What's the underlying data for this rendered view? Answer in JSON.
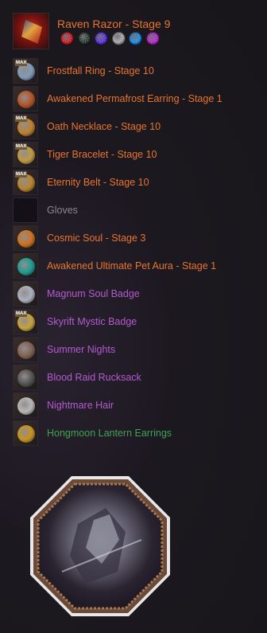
{
  "weapon": {
    "name": "Raven Razor - Stage 9",
    "gems": [
      {
        "icon": "red-gem-icon",
        "color": "#c8202c"
      },
      {
        "icon": "black-gem-icon",
        "color": "#2a3a34"
      },
      {
        "icon": "purple-gem-icon",
        "color": "#5a32d8"
      },
      {
        "icon": "white-gem-icon",
        "color": "#a8a8a8"
      },
      {
        "icon": "blue-gem-icon",
        "color": "#1f8ae0"
      },
      {
        "icon": "magenta-gem-icon",
        "color": "#b02ac8"
      }
    ]
  },
  "equipment": [
    {
      "label": "Frostfall Ring - Stage 10",
      "icon": "ring-icon",
      "rarity": "orange",
      "max": "MAX",
      "color": "#8aa8c8"
    },
    {
      "label": "Awakened Permafrost Earring - Stage 1",
      "icon": "earring-icon",
      "rarity": "orange",
      "max": "",
      "color": "#c45a2a"
    },
    {
      "label": "Oath Necklace - Stage 10",
      "icon": "necklace-icon",
      "rarity": "orange",
      "max": "MAX",
      "color": "#d08a30"
    },
    {
      "label": "Tiger Bracelet - Stage 10",
      "icon": "bracelet-icon",
      "rarity": "orange",
      "max": "MAX",
      "color": "#d0a848"
    },
    {
      "label": "Eternity Belt - Stage 10",
      "icon": "belt-icon",
      "rarity": "orange",
      "max": "MAX",
      "color": "#c89030"
    },
    {
      "label": "Gloves",
      "icon": "empty-slot-icon",
      "rarity": "gray",
      "max": "",
      "color": ""
    },
    {
      "label": "Cosmic Soul - Stage 3",
      "icon": "soul-icon",
      "rarity": "orange",
      "max": "",
      "color": "#e07a20"
    },
    {
      "label": "Awakened Ultimate Pet Aura - Stage 1",
      "icon": "pet-aura-icon",
      "rarity": "orange",
      "max": "",
      "color": "#20a8a0"
    },
    {
      "label": "Magnum Soul Badge",
      "icon": "soul-badge-icon",
      "rarity": "purple",
      "max": "",
      "color": "#b8c0d0"
    },
    {
      "label": "Skyrift Mystic Badge",
      "icon": "mystic-badge-icon",
      "rarity": "purple",
      "max": "MAX",
      "color": "#d8b040"
    },
    {
      "label": "Summer Nights",
      "icon": "outfit-icon",
      "rarity": "purple",
      "max": "",
      "color": "#8a6a5a"
    },
    {
      "label": "Blood Raid Rucksack",
      "icon": "rucksack-icon",
      "rarity": "purple",
      "max": "",
      "color": "#5a5a5a"
    },
    {
      "label": "Nightmare Hair",
      "icon": "hair-icon",
      "rarity": "purple",
      "max": "",
      "color": "#c8c8c8"
    },
    {
      "label": "Hongmoon Lantern Earrings",
      "icon": "lantern-earrings-icon",
      "rarity": "green",
      "max": "",
      "color": "#d8a020"
    }
  ]
}
